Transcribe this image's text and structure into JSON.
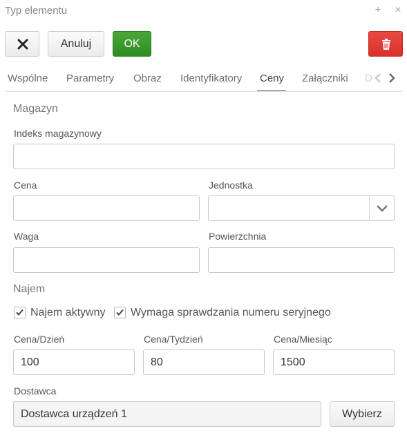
{
  "window": {
    "title": "Typ elementu"
  },
  "toolbar": {
    "cancel_label": "Anuluj",
    "ok_label": "OK"
  },
  "tabs": [
    {
      "label": "Wspólne"
    },
    {
      "label": "Parametry"
    },
    {
      "label": "Obraz"
    },
    {
      "label": "Identyfikatory"
    },
    {
      "label": "Ceny"
    },
    {
      "label": "Załączniki"
    }
  ],
  "active_tab": "Ceny",
  "magazyn": {
    "title": "Magazyn",
    "index_label": "Indeks magazynowy",
    "index_value": "",
    "price_label": "Cena",
    "price_value": "",
    "unit_label": "Jednostka",
    "unit_value": "",
    "weight_label": "Waga",
    "weight_value": "",
    "area_label": "Powierzchnia",
    "area_value": ""
  },
  "najem": {
    "title": "Najem",
    "rent_active_label": "Najem aktywny",
    "rent_active": true,
    "serial_check_label": "Wymaga sprawdzania numeru seryjnego",
    "serial_check": true,
    "day_label": "Cena/Dzień",
    "day_value": "100",
    "week_label": "Cena/Tydzień",
    "week_value": "80",
    "month_label": "Cena/Miesiąc",
    "month_value": "1500"
  },
  "supplier": {
    "label": "Dostawca",
    "value": "Dostawca urządzeń 1",
    "choose_label": "Wybierz"
  },
  "colors": {
    "ok": "#3a9a2e",
    "delete": "#e03a35"
  }
}
